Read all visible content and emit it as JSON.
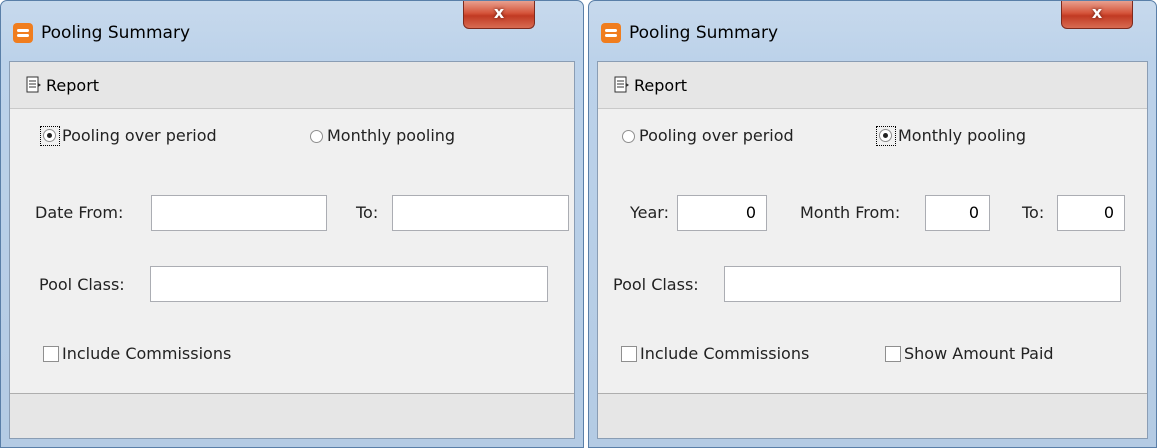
{
  "left_window": {
    "title": "Pooling Summary",
    "close_label": "x",
    "toolbar": {
      "report_label": "Report"
    },
    "radio_period_label": "Pooling over period",
    "radio_monthly_label": "Monthly pooling",
    "selected_mode": "Pooling over period",
    "date_from_label": "Date From:",
    "date_from_value": "",
    "to_label": "To:",
    "to_value": "",
    "pool_class_label": "Pool Class:",
    "pool_class_value": "",
    "include_commissions_label": "Include Commissions",
    "include_commissions_checked": false
  },
  "right_window": {
    "title": "Pooling Summary",
    "close_label": "x",
    "toolbar": {
      "report_label": "Report"
    },
    "radio_period_label": "Pooling over period",
    "radio_monthly_label": "Monthly pooling",
    "selected_mode": "Monthly pooling",
    "year_label": "Year:",
    "year_value": "0",
    "month_from_label": "Month From:",
    "month_from_value": "0",
    "to_label": "To:",
    "to_value": "0",
    "pool_class_label": "Pool Class:",
    "pool_class_value": "",
    "include_commissions_label": "Include Commissions",
    "include_commissions_checked": false,
    "show_amount_paid_label": "Show Amount Paid",
    "show_amount_paid_checked": false
  },
  "colors": {
    "app_icon": "#f07d1e",
    "close_button": "#c13a23",
    "window_frame": "#bcd2ea"
  }
}
